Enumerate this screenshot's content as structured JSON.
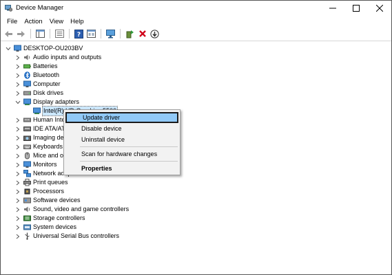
{
  "window": {
    "title": "Device Manager"
  },
  "menu": [
    "File",
    "Action",
    "View",
    "Help"
  ],
  "tree": {
    "root": "DESKTOP-OU203BV",
    "categories": [
      {
        "label": "Audio inputs and outputs",
        "icon": "speaker-icon"
      },
      {
        "label": "Batteries",
        "icon": "battery-icon"
      },
      {
        "label": "Bluetooth",
        "icon": "bluetooth-icon"
      },
      {
        "label": "Computer",
        "icon": "computer-icon"
      },
      {
        "label": "Disk drives",
        "icon": "disk-drive-icon"
      },
      {
        "label": "Display adapters",
        "icon": "display-adapter-icon",
        "expanded": true
      },
      {
        "label": "Intel(R) HD Graphics 5500",
        "icon": "display-adapter-icon",
        "child": true
      },
      {
        "label": "Human Interface Devices",
        "icon": "hid-icon"
      },
      {
        "label": "IDE ATA/ATAPI controllers",
        "icon": "ide-icon"
      },
      {
        "label": "Imaging devices",
        "icon": "camera-icon"
      },
      {
        "label": "Keyboards",
        "icon": "keyboard-icon"
      },
      {
        "label": "Mice and other pointing devices",
        "icon": "mouse-icon"
      },
      {
        "label": "Monitors",
        "icon": "monitor-icon"
      },
      {
        "label": "Network adapters",
        "icon": "network-icon"
      },
      {
        "label": "Print queues",
        "icon": "printer-icon"
      },
      {
        "label": "Processors",
        "icon": "processor-icon"
      },
      {
        "label": "Software devices",
        "icon": "software-device-icon"
      },
      {
        "label": "Sound, video and game controllers",
        "icon": "sound-icon"
      },
      {
        "label": "Storage controllers",
        "icon": "storage-icon"
      },
      {
        "label": "System devices",
        "icon": "system-device-icon"
      },
      {
        "label": "Universal Serial Bus controllers",
        "icon": "usb-icon"
      }
    ]
  },
  "context_menu": {
    "update_driver": "Update driver",
    "disable_device": "Disable device",
    "uninstall_device": "Uninstall device",
    "scan_changes": "Scan for hardware changes",
    "properties": "Properties"
  }
}
